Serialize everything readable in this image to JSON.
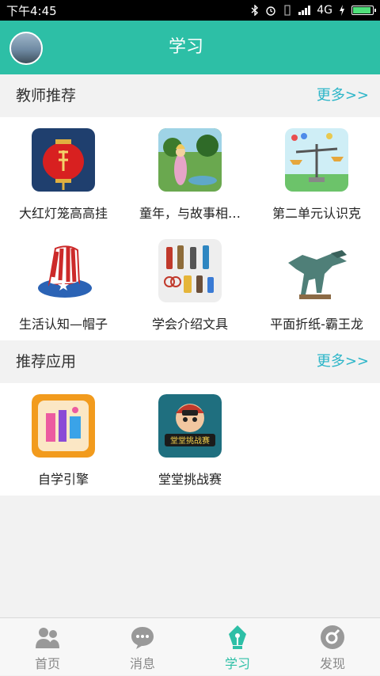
{
  "status_bar": {
    "time": "下午4:45",
    "network": "4G",
    "icons": [
      "bluetooth-icon",
      "alarm-icon",
      "vibrate-icon",
      "signal-icon",
      "charging-icon",
      "battery-icon"
    ]
  },
  "header": {
    "title": "学习",
    "avatar_icon": "user-avatar"
  },
  "sections": [
    {
      "title": "教师推荐",
      "more_label": "更多>>",
      "items": [
        {
          "label": "大红灯笼高高挂",
          "icon": "red-lantern-thumbnail"
        },
        {
          "label": "童年，与故事相…",
          "icon": "fairy-tale-thumbnail"
        },
        {
          "label": "第二单元认识克",
          "icon": "balance-scale-thumbnail"
        },
        {
          "label": "生活认知—帽子",
          "icon": "hat-thumbnail"
        },
        {
          "label": "学会介绍文具",
          "icon": "stationery-thumbnail"
        },
        {
          "label": "平面折纸-霸王龙",
          "icon": "origami-dinosaur-thumbnail"
        }
      ]
    },
    {
      "title": "推荐应用",
      "more_label": "更多>>",
      "items": [
        {
          "label": "自学引擎",
          "icon": "self-study-app-icon"
        },
        {
          "label": "堂堂挑战赛",
          "icon": "challenge-app-icon",
          "badge_text": "堂堂挑战赛"
        }
      ]
    }
  ],
  "tab_bar": {
    "active": "学习",
    "accent_color": "#2dbfa6",
    "tabs": [
      {
        "label": "首页",
        "icon": "people-icon"
      },
      {
        "label": "消息",
        "icon": "chat-bubble-icon"
      },
      {
        "label": "学习",
        "icon": "pen-nib-icon"
      },
      {
        "label": "发现",
        "icon": "compass-icon"
      }
    ]
  }
}
